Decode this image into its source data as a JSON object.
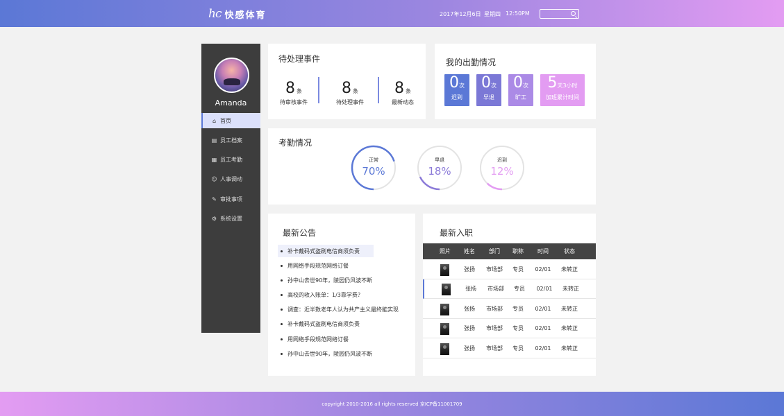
{
  "header": {
    "logo_mark": "hc",
    "logo_text": "快感体育",
    "date": "2017年12月6日",
    "weekday": "星期四",
    "time": "12:50PM",
    "search_placeholder": ""
  },
  "sidebar": {
    "username": "Amanda",
    "items": [
      {
        "label": "首页",
        "icon": "⌂",
        "icon_name": "home-icon"
      },
      {
        "label": "员工档案",
        "icon": "▤",
        "icon_name": "archive-icon"
      },
      {
        "label": "员工考勤",
        "icon": "▦",
        "icon_name": "calendar-icon"
      },
      {
        "label": "人事调动",
        "icon": "☺",
        "icon_name": "user-icon"
      },
      {
        "label": "审批事项",
        "icon": "✎",
        "icon_name": "approval-icon"
      },
      {
        "label": "系统设置",
        "icon": "⚙",
        "icon_name": "gear-icon"
      }
    ]
  },
  "pending": {
    "title": "待处理事件",
    "stats": [
      {
        "num": "8",
        "unit": "条",
        "label": "待审核事件"
      },
      {
        "num": "8",
        "unit": "条",
        "label": "待处理事件"
      },
      {
        "num": "8",
        "unit": "条",
        "label": "最新动态"
      }
    ]
  },
  "attendance": {
    "title": "我的出勤情况",
    "boxes": [
      {
        "num": "0",
        "unit": "次",
        "label": "迟到",
        "color": "#5b78d6"
      },
      {
        "num": "0",
        "unit": "次",
        "label": "早退",
        "color": "#7b78d6"
      },
      {
        "num": "0",
        "unit": "次",
        "label": "旷工",
        "color": "#ab8ae6"
      },
      {
        "num": "5",
        "unit": "天3小时",
        "label": "加班累计时间",
        "color": "#e39cf2"
      }
    ]
  },
  "kaoqin": {
    "title": "考勤情况",
    "rings": [
      {
        "label": "正常",
        "value": "70%",
        "fraction": 0.7,
        "color": "#5b78d6"
      },
      {
        "label": "早退",
        "value": "18%",
        "fraction": 0.18,
        "color": "#8b7ad8"
      },
      {
        "label": "迟到",
        "value": "12%",
        "fraction": 0.12,
        "color": "#e39cf2"
      }
    ]
  },
  "notice": {
    "title": "最新公告",
    "items": [
      "补卡戴码式盗刷电信商须负责",
      "用网络手段规范网络订餐",
      "孙中山去世90年，陵园仍风波不断",
      "高校的收入账单：1/3靠学费？",
      "调查：近半数老年人认为共产主义最终能实现",
      "补卡戴码式盗刷电信商须负责",
      "用网络手段规范网络订餐",
      "孙中山去世90年，陵园仍风波不断"
    ]
  },
  "hires": {
    "title": "最新入职",
    "columns": [
      "照片",
      "姓名",
      "部门",
      "职称",
      "时间",
      "状态"
    ],
    "rows": [
      {
        "name": "张扬",
        "dept": "市场部",
        "title": "专员",
        "time": "02/01",
        "status": "未转正"
      },
      {
        "name": "张扬",
        "dept": "市场部",
        "title": "专员",
        "time": "02/01",
        "status": "未转正"
      },
      {
        "name": "张扬",
        "dept": "市场部",
        "title": "专员",
        "time": "02/01",
        "status": "未转正"
      },
      {
        "name": "张扬",
        "dept": "市场部",
        "title": "专员",
        "time": "02/01",
        "status": "未转正"
      },
      {
        "name": "张扬",
        "dept": "市场部",
        "title": "专员",
        "time": "02/01",
        "status": "未转正"
      }
    ]
  },
  "footer": {
    "copyright": "copyright 2010-2016  all rights reserved 京ICP备11001709"
  }
}
